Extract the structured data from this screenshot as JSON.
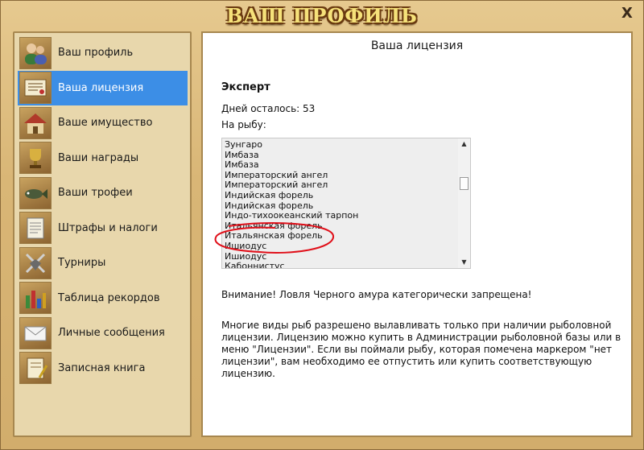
{
  "window": {
    "title": "ВАШ ПРОФИЛЬ",
    "close_label": "X"
  },
  "sidebar": {
    "items": [
      {
        "label": "Ваш профиль",
        "icon": "people-icon",
        "active": false
      },
      {
        "label": "Ваша лицензия",
        "icon": "license-icon",
        "active": true
      },
      {
        "label": "Ваше имущество",
        "icon": "house-icon",
        "active": false
      },
      {
        "label": "Ваши награды",
        "icon": "trophy-icon",
        "active": false
      },
      {
        "label": "Ваши трофеи",
        "icon": "fish-icon",
        "active": false
      },
      {
        "label": "Штрафы и налоги",
        "icon": "document-icon",
        "active": false
      },
      {
        "label": "Турниры",
        "icon": "tournament-icon",
        "active": false
      },
      {
        "label": "Таблица рекордов",
        "icon": "bar-chart-icon",
        "active": false
      },
      {
        "label": "Личные сообщения",
        "icon": "envelope-icon",
        "active": false
      },
      {
        "label": "Записная книга",
        "icon": "notebook-icon",
        "active": false
      }
    ]
  },
  "main": {
    "title": "Ваша лицензия",
    "license_level": "Эксперт",
    "days_left": "Дней осталось: 53",
    "fishing_label": "На рыбу:",
    "fish": [
      "Зунгаро",
      "Имбаза",
      "Имбаза",
      "Императорский ангел",
      "Императорский ангел",
      "Индийская форель",
      "Индийская форель",
      "Индо-тихоокеанский тарпон",
      "Итальянская форель",
      "Итальянская форель",
      "Ишиодус",
      "Ишиодус",
      "Кабоннистус"
    ],
    "warning": "Внимание! Ловля Черного амура категорически запрещена!",
    "info": "Многие виды рыб разрешено вылавливать только при наличии рыболовной лицензии. Лицензию можно купить в Администрации рыболовной базы или в меню \"Лицензии\". Если вы поймали рыбу, которая помечена маркером \"нет лицензии\", вам необходимо ее отпустить или купить соответствующую лицензию."
  },
  "colors": {
    "accent": "#3c8ee6",
    "annotation": "#e0101a"
  }
}
